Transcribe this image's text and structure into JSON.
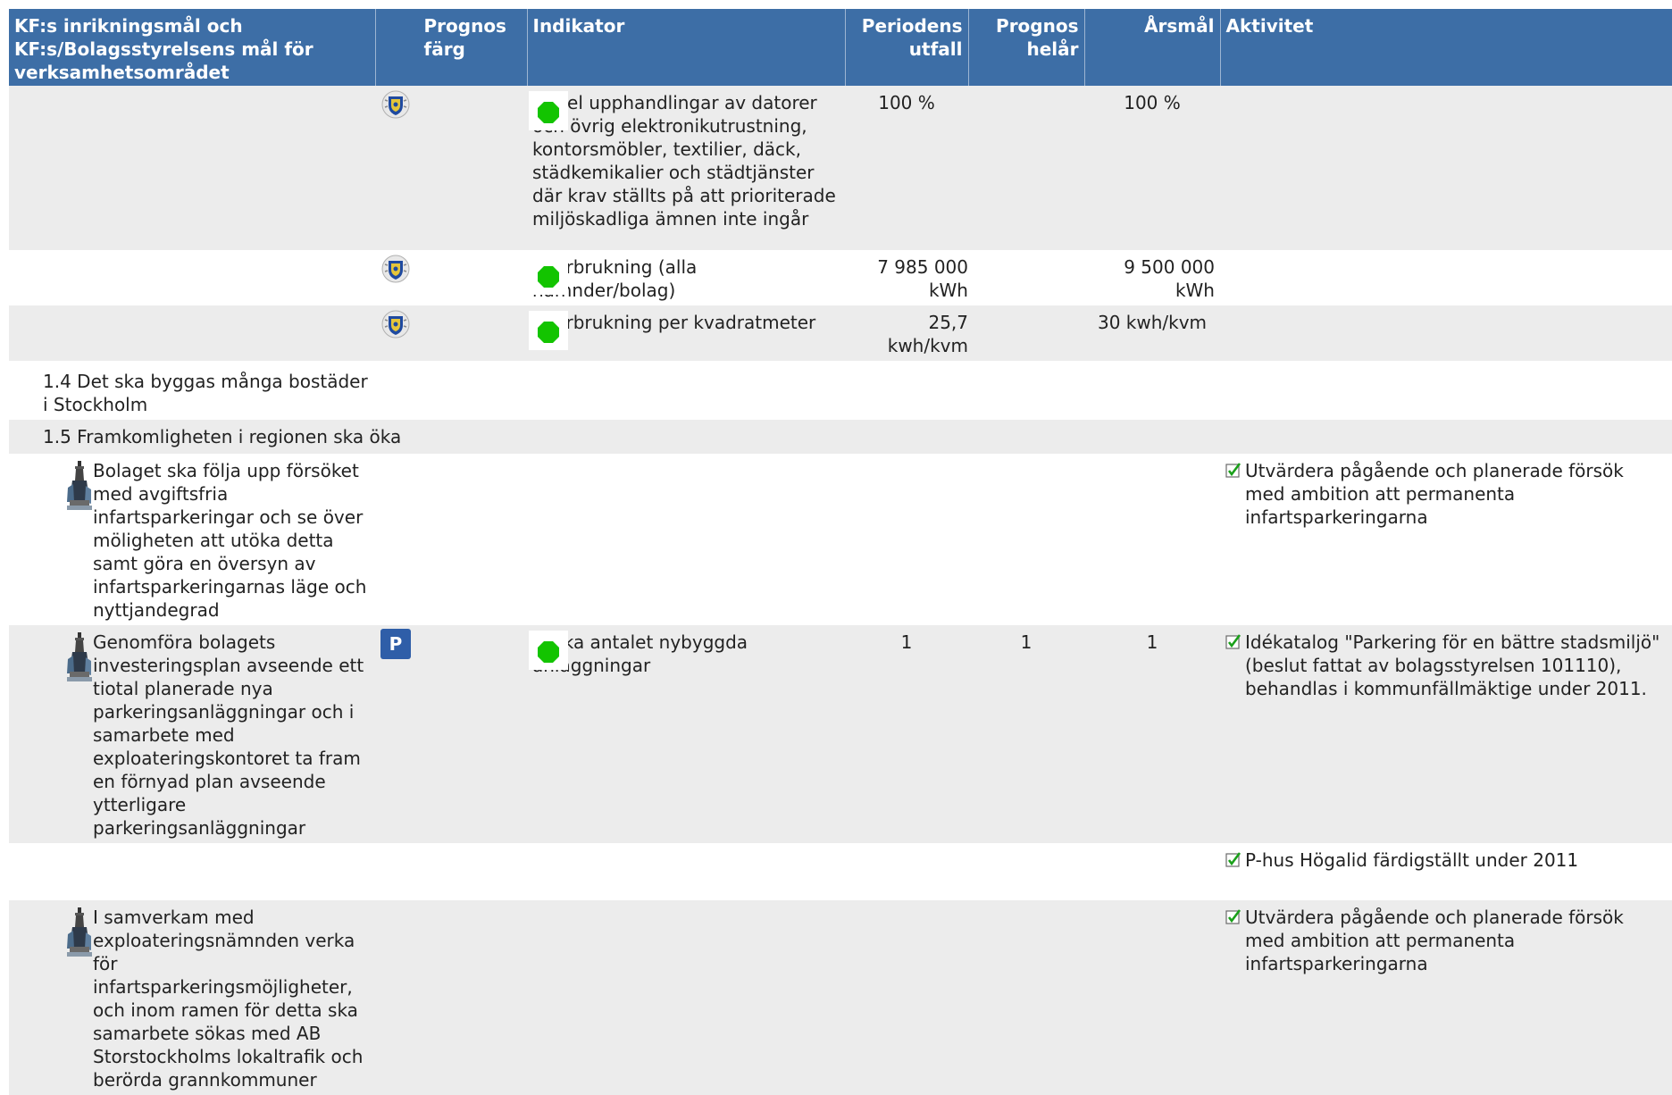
{
  "header": {
    "goal": "KF:s inrikningsmål och KF:s/Bolagsstyrelsens mål för verksamhetsområdet",
    "prognos_farg": "Prognos färg",
    "indikator": "Indikator",
    "periodens_utfall": "Periodens utfall",
    "prognos_helar": "Prognos helår",
    "arsmal": "Årsmål",
    "aktivitet": "Aktivitet"
  },
  "rows": [
    {
      "goal": "",
      "indicator": "Andel upphandlingar av datorer och övrig elektronikutrustning, kontorsmöbler, textilier, däck, städkemikalier och städtjänster där krav ställts på att prioriterade miljöskadliga ämnen inte ingår",
      "utfall": "100 %",
      "prognos": "",
      "arsmal": "100 %",
      "status_color": "#13c400"
    },
    {
      "goal": "",
      "indicator": "Elförbrukning (alla nämnder/bolag)",
      "utfall": "7 985 000 kWh",
      "prognos": "",
      "arsmal": "9 500 000 kWh",
      "status_color": "#13c400"
    },
    {
      "goal": "",
      "indicator": "Elförbrukning per kvadratmeter",
      "utfall": "25,7 kwh/kvm",
      "prognos": "",
      "arsmal": "30 kwh/kvm",
      "status_color": "#13c400"
    },
    {
      "goal": "1.4 Det ska byggas många bostäder i Stockholm"
    },
    {
      "goal": "1.5 Framkomligheten i regionen ska öka"
    },
    {
      "goal": "Bolaget ska följa upp försöket med avgiftsfria infartsparkeringar och se över möligheten att utöka detta samt göra en översyn av infartsparkeringarnas läge och nyttjandegrad",
      "activity": "Utvärdera pågående och planerade försök med ambition att permanenta infartsparkeringarna"
    },
    {
      "goal": "Genomföra bolagets investeringsplan avseende ett tiotal planerade nya parkeringsanläggningar och i samarbete med exploateringskontoret ta fram en förnyad plan avseende ytterligare parkeringsanläggningar",
      "p_icon": "P",
      "indicator": "Utöka antalet nybyggda anläggningar",
      "utfall": "1",
      "prognos": "1",
      "arsmal": "1",
      "status_color": "#13c400",
      "activity": "Idékatalog \"Parkering för en bättre stadsmiljö\" (beslut fattat av bolagsstyrelsen 101110), behandlas i kommunfällmäktige under 2011."
    },
    {
      "activity": "P-hus Högalid färdigställt under 2011"
    },
    {
      "goal": "I samverkam med exploateringsnämnden verka för infartsparkeringsmöjligheter, och inom ramen för detta ska samarbete sökas med AB Storstockholms lokaltrafik och berörda grannkommuner",
      "activity": "Utvärdera pågående och planerade försök med ambition att permanenta infartsparkeringarna"
    }
  ]
}
